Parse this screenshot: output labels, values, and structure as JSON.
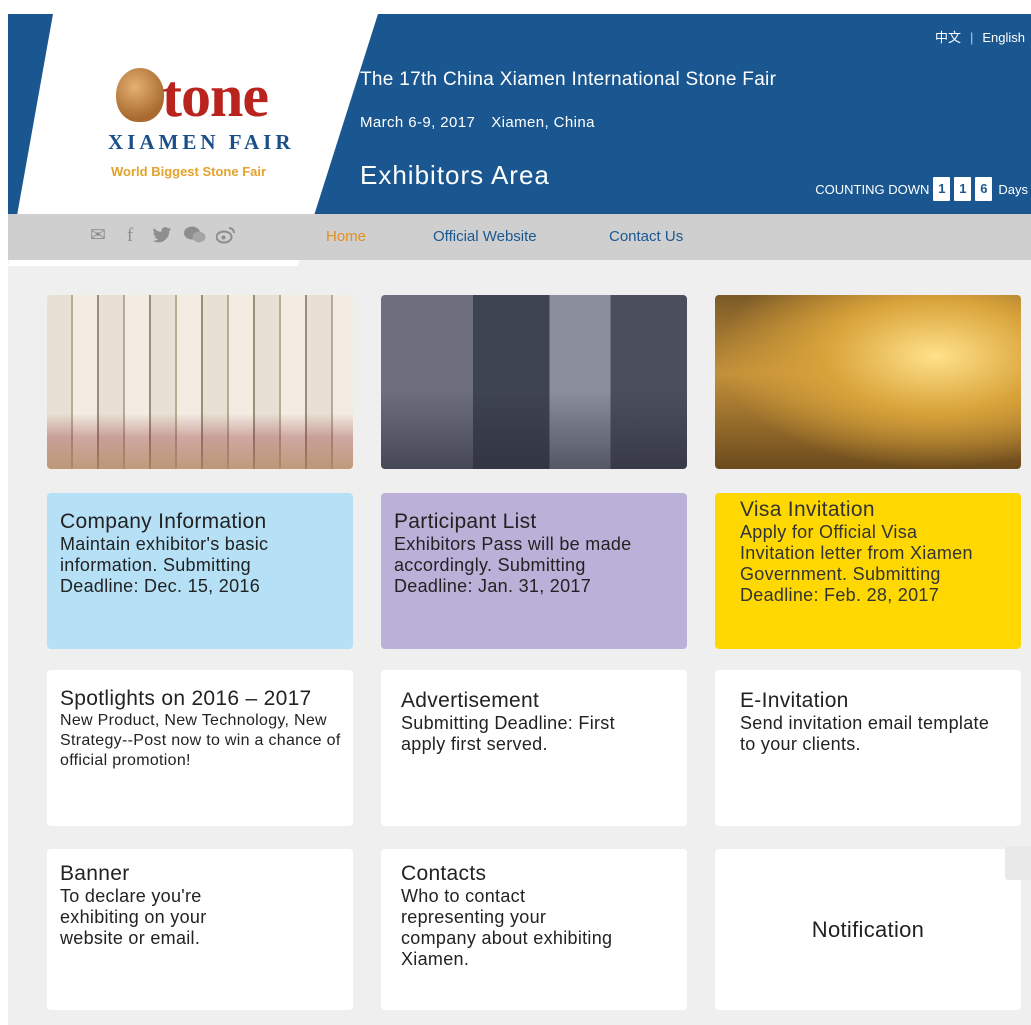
{
  "header": {
    "logo": {
      "word": "tone",
      "sub": "XIAMEN FAIR",
      "tagline": "World Biggest Stone Fair"
    },
    "lang": {
      "chinese": "中文",
      "english": "English"
    },
    "title": "The 17th China Xiamen International Stone Fair",
    "date": "March 6-9, 2017",
    "location": "Xiamen, China",
    "area": "Exhibitors Area",
    "countdown": {
      "label": "COUNTING DOWN",
      "digits": [
        "1",
        "1",
        "6"
      ],
      "unit": "Days"
    }
  },
  "nav": {
    "social_icons": [
      "mail-icon",
      "facebook-icon",
      "twitter-icon",
      "wechat-icon",
      "weibo-icon"
    ],
    "items": [
      "Home",
      "Official Website",
      "Contact Us"
    ],
    "active": "Home"
  },
  "photos": [
    "stone-tiles-photo",
    "exhibition-hall-photo",
    "stone-lounge-photo"
  ],
  "cards": [
    {
      "title": "Company Information",
      "desc": "Maintain exhibitor's basic information. Submitting Deadline: Dec. 15, 2016",
      "color": "#b5e0f6"
    },
    {
      "title": "Participant List",
      "desc": "Exhibitors Pass will be made accordingly. Submitting Deadline: Jan. 31, 2017",
      "color": "#bbb0d8"
    },
    {
      "title": "Visa Invitation",
      "desc": "Apply for Official Visa Invitation letter from Xiamen Government. Submitting Deadline: Feb. 28, 2017",
      "color": "#fed800"
    },
    {
      "title": "Spotlights on 2016 – 2017",
      "desc": "New Product, New Technology, New Strategy--Post now to win a chance of official promotion!",
      "color": "#ffffff"
    },
    {
      "title": "Advertisement",
      "desc": "Submitting Deadline: First apply first served.",
      "color": "#ffffff"
    },
    {
      "title": "E-Invitation",
      "desc": "Send invitation email template to your clients.",
      "color": "#ffffff"
    },
    {
      "title": "Banner",
      "desc": "To declare you're exhibiting on your website or email.",
      "color": "#ffffff"
    },
    {
      "title": "Contacts",
      "desc": "Who to contact representing your company about exhibiting Xiamen.",
      "color": "#ffffff"
    },
    {
      "title": "Notification",
      "desc": "",
      "color": "#ffffff"
    }
  ],
  "colors": {
    "header": "#1a5790",
    "nav": "#cfcfcf",
    "active_nav": "#e18f1e",
    "background": "#efefef"
  }
}
